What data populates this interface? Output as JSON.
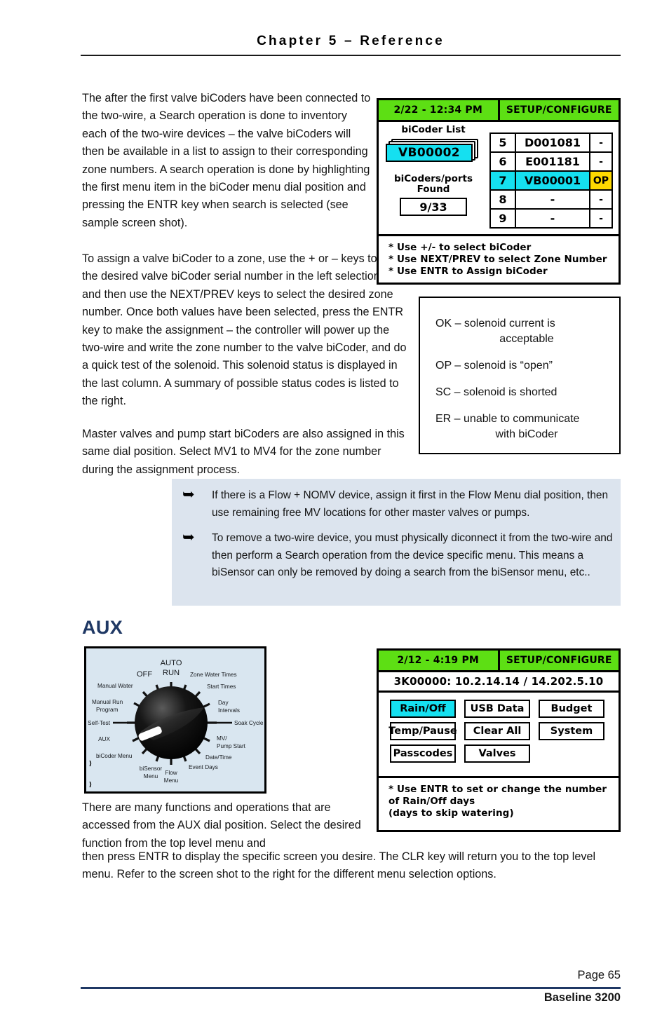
{
  "header": {
    "chapter_title": "Chapter 5 – Reference"
  },
  "body": {
    "para1": "The after the first valve biCoders have been connected to the two-wire, a Search operation is done to inventory each of the two-wire devices – the valve biCoders will then be available in a list to assign to their corresponding zone numbers.  A search operation is done by highlighting the first menu item in the biCoder menu dial position and pressing the ENTR key when search is selected (see sample screen shot).",
    "para2": "To assign a valve biCoder to a zone, use the + or – keys to select the desired valve biCoder serial number in the left selection box and then use the NEXT/PREV keys to select the desired zone number.  Once both values have been selected, press the ENTR key to make the assignment – the controller will power up the two-wire and write the zone number to the valve biCoder, and do a quick test of the solenoid.  This solenoid status is displayed in the last column.  A summary of possible status codes is listed to the right.",
    "para3": "Master valves and pump start biCoders are also assigned in this same dial position.  Select MV1 to MV4 for the zone number during the assignment process.",
    "para_bottom_left": "There are many functions and operations that are accessed from the AUX dial position.  Select the desired function from the top level menu and",
    "para_bottom_wide": "then press ENTR to display the specific screen you desire.  The CLR key will return you to the top level menu.  Refer to the screen shot to the right for the different menu selection options."
  },
  "lcd_bicoder": {
    "title_left": "2/22 - 12:34 PM",
    "title_right": "SETUP/CONFIGURE",
    "list_label": "biCoder List",
    "selected_bicoder": "VB00002",
    "found_label_line1": "biCoders/ports",
    "found_label_line2": "Found",
    "found_value": "9/33",
    "rows": [
      {
        "index": "5",
        "serial": "D001081",
        "status": "-",
        "selected": false
      },
      {
        "index": "6",
        "serial": "E001181",
        "status": "-",
        "selected": false
      },
      {
        "index": "7",
        "serial": "VB00001",
        "status": "OP",
        "selected": true
      },
      {
        "index": "8",
        "serial": "-",
        "status": "-",
        "selected": false
      },
      {
        "index": "9",
        "serial": "-",
        "status": "-",
        "selected": false
      }
    ],
    "hints": [
      "* Use +/- to select biCoder",
      "* Use NEXT/PREV to select Zone Number",
      "* Use ENTR to Assign biCoder"
    ]
  },
  "status_codes": [
    {
      "code_line": "OK – solenoid current is",
      "cont_line": "acceptable"
    },
    {
      "code_line": "OP – solenoid is “open”",
      "cont_line": ""
    },
    {
      "code_line": "SC – solenoid is shorted",
      "cont_line": ""
    },
    {
      "code_line": "ER – unable to communicate",
      "cont_line": "with biCoder"
    }
  ],
  "notes": {
    "arrow_glyph": "➥",
    "items": [
      "If there is a Flow + NOMV device, assign it first in the Flow Menu dial position, then use remaining free MV locations for other master valves or pumps.",
      "To remove a two-wire device, you must physically diconnect it from the two-wire and then perform a Search operation from the device specific menu.  This means a biSensor can only be removed by doing a search from the biSensor menu, etc.."
    ]
  },
  "aux_section": {
    "heading": "AUX"
  },
  "dial": {
    "labels": {
      "auto": "AUTO",
      "run": "RUN",
      "off": "OFF",
      "zone_water_times": "Zone Water Times",
      "start_times": "Start Times",
      "day": "Day",
      "intervals": "Intervals",
      "soak_cycle": "Soak Cycle",
      "mv": "MV/",
      "pump_start": "Pump Start",
      "date_time": "Date/Time",
      "event_days": "Event Days",
      "flow_menu_1": "Flow",
      "flow_menu_2": "Menu",
      "bisensor_1": "biSensor",
      "bisensor_2": "Menu",
      "bicoder_menu": "biCoder Menu",
      "aux": "AUX",
      "self_test": "Self-Test",
      "manual_run": "Manual Run",
      "program": "Program",
      "manual_water": "Manual Water"
    }
  },
  "lcd_aux": {
    "title_left": "2/12 - 4:19 PM",
    "title_right": "SETUP/CONFIGURE",
    "version_line": "3K00000: 10.2.14.14 / 14.202.5.10",
    "buttons": [
      [
        {
          "label": "Rain/Off",
          "selected": true
        },
        {
          "label": "USB Data",
          "selected": false
        },
        {
          "label": "Budget",
          "selected": false
        }
      ],
      [
        {
          "label": "Temp/Pause",
          "selected": false
        },
        {
          "label": "Clear All",
          "selected": false
        },
        {
          "label": "System",
          "selected": false
        }
      ],
      [
        {
          "label": "Passcodes",
          "selected": false
        },
        {
          "label": "Valves",
          "selected": false
        },
        {
          "label": "",
          "selected": false
        }
      ]
    ],
    "hints": [
      "* Use ENTR to set or change the number",
      "   of Rain/Off days",
      "   (days to skip watering)"
    ]
  },
  "footer": {
    "page": "Page 65",
    "product": "Baseline 3200"
  },
  "colors": {
    "lcd_titlebar_green": "#5ddf14",
    "lcd_highlight_cyan": "#15e0f0",
    "lcd_status_yellow": "#ffd900",
    "note_background": "#dce4ee",
    "dial_background": "#d9e6f0",
    "heading_navy": "#1f3864"
  }
}
